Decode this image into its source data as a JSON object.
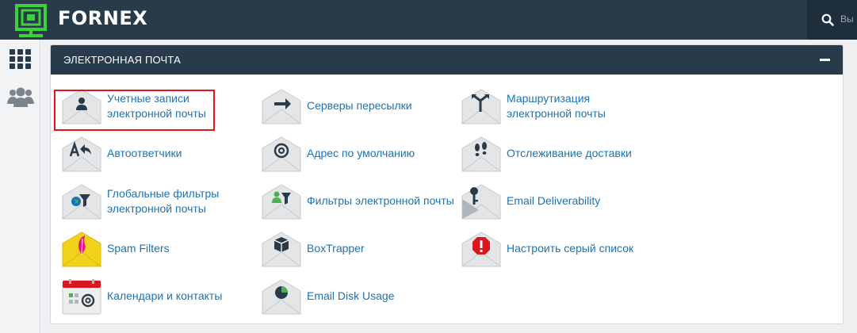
{
  "header": {
    "brand": "FORNEX",
    "search_placeholder": "Вы"
  },
  "panel": {
    "title": "ЭЛЕКТРОННАЯ ПОЧТА"
  },
  "items": [
    {
      "label": "Учетные записи\nэлектронной почты",
      "icon": "account-envelope-icon"
    },
    {
      "label": "Серверы пересылки",
      "icon": "forwarder-envelope-icon"
    },
    {
      "label": "Маршрутизация\nэлектронной почты",
      "icon": "routing-envelope-icon"
    },
    {
      "label": "Автоответчики",
      "icon": "autoresponder-envelope-icon"
    },
    {
      "label": "Адрес по умолчанию",
      "icon": "default-address-envelope-icon"
    },
    {
      "label": "Отслеживание доставки",
      "icon": "track-delivery-envelope-icon"
    },
    {
      "label": "Глобальные фильтры\nэлектронной почты",
      "icon": "global-filter-envelope-icon"
    },
    {
      "label": "Фильтры электронной почты",
      "icon": "user-filter-envelope-icon"
    },
    {
      "label": "Email Deliverability",
      "icon": "deliverability-envelope-icon"
    },
    {
      "label": "Spam Filters",
      "icon": "spam-filter-envelope-icon"
    },
    {
      "label": "BoxTrapper",
      "icon": "boxtrapper-envelope-icon"
    },
    {
      "label": "Настроить серый список",
      "icon": "greylist-envelope-icon"
    },
    {
      "label": "Календари и контакты",
      "icon": "calendar-contacts-icon"
    },
    {
      "label": "Email Disk Usage",
      "icon": "disk-usage-envelope-icon"
    }
  ],
  "colors": {
    "topbar": "#293a4a",
    "link": "#1a73b5",
    "highlight": "#e3151a",
    "logo": "#3ad13a"
  }
}
